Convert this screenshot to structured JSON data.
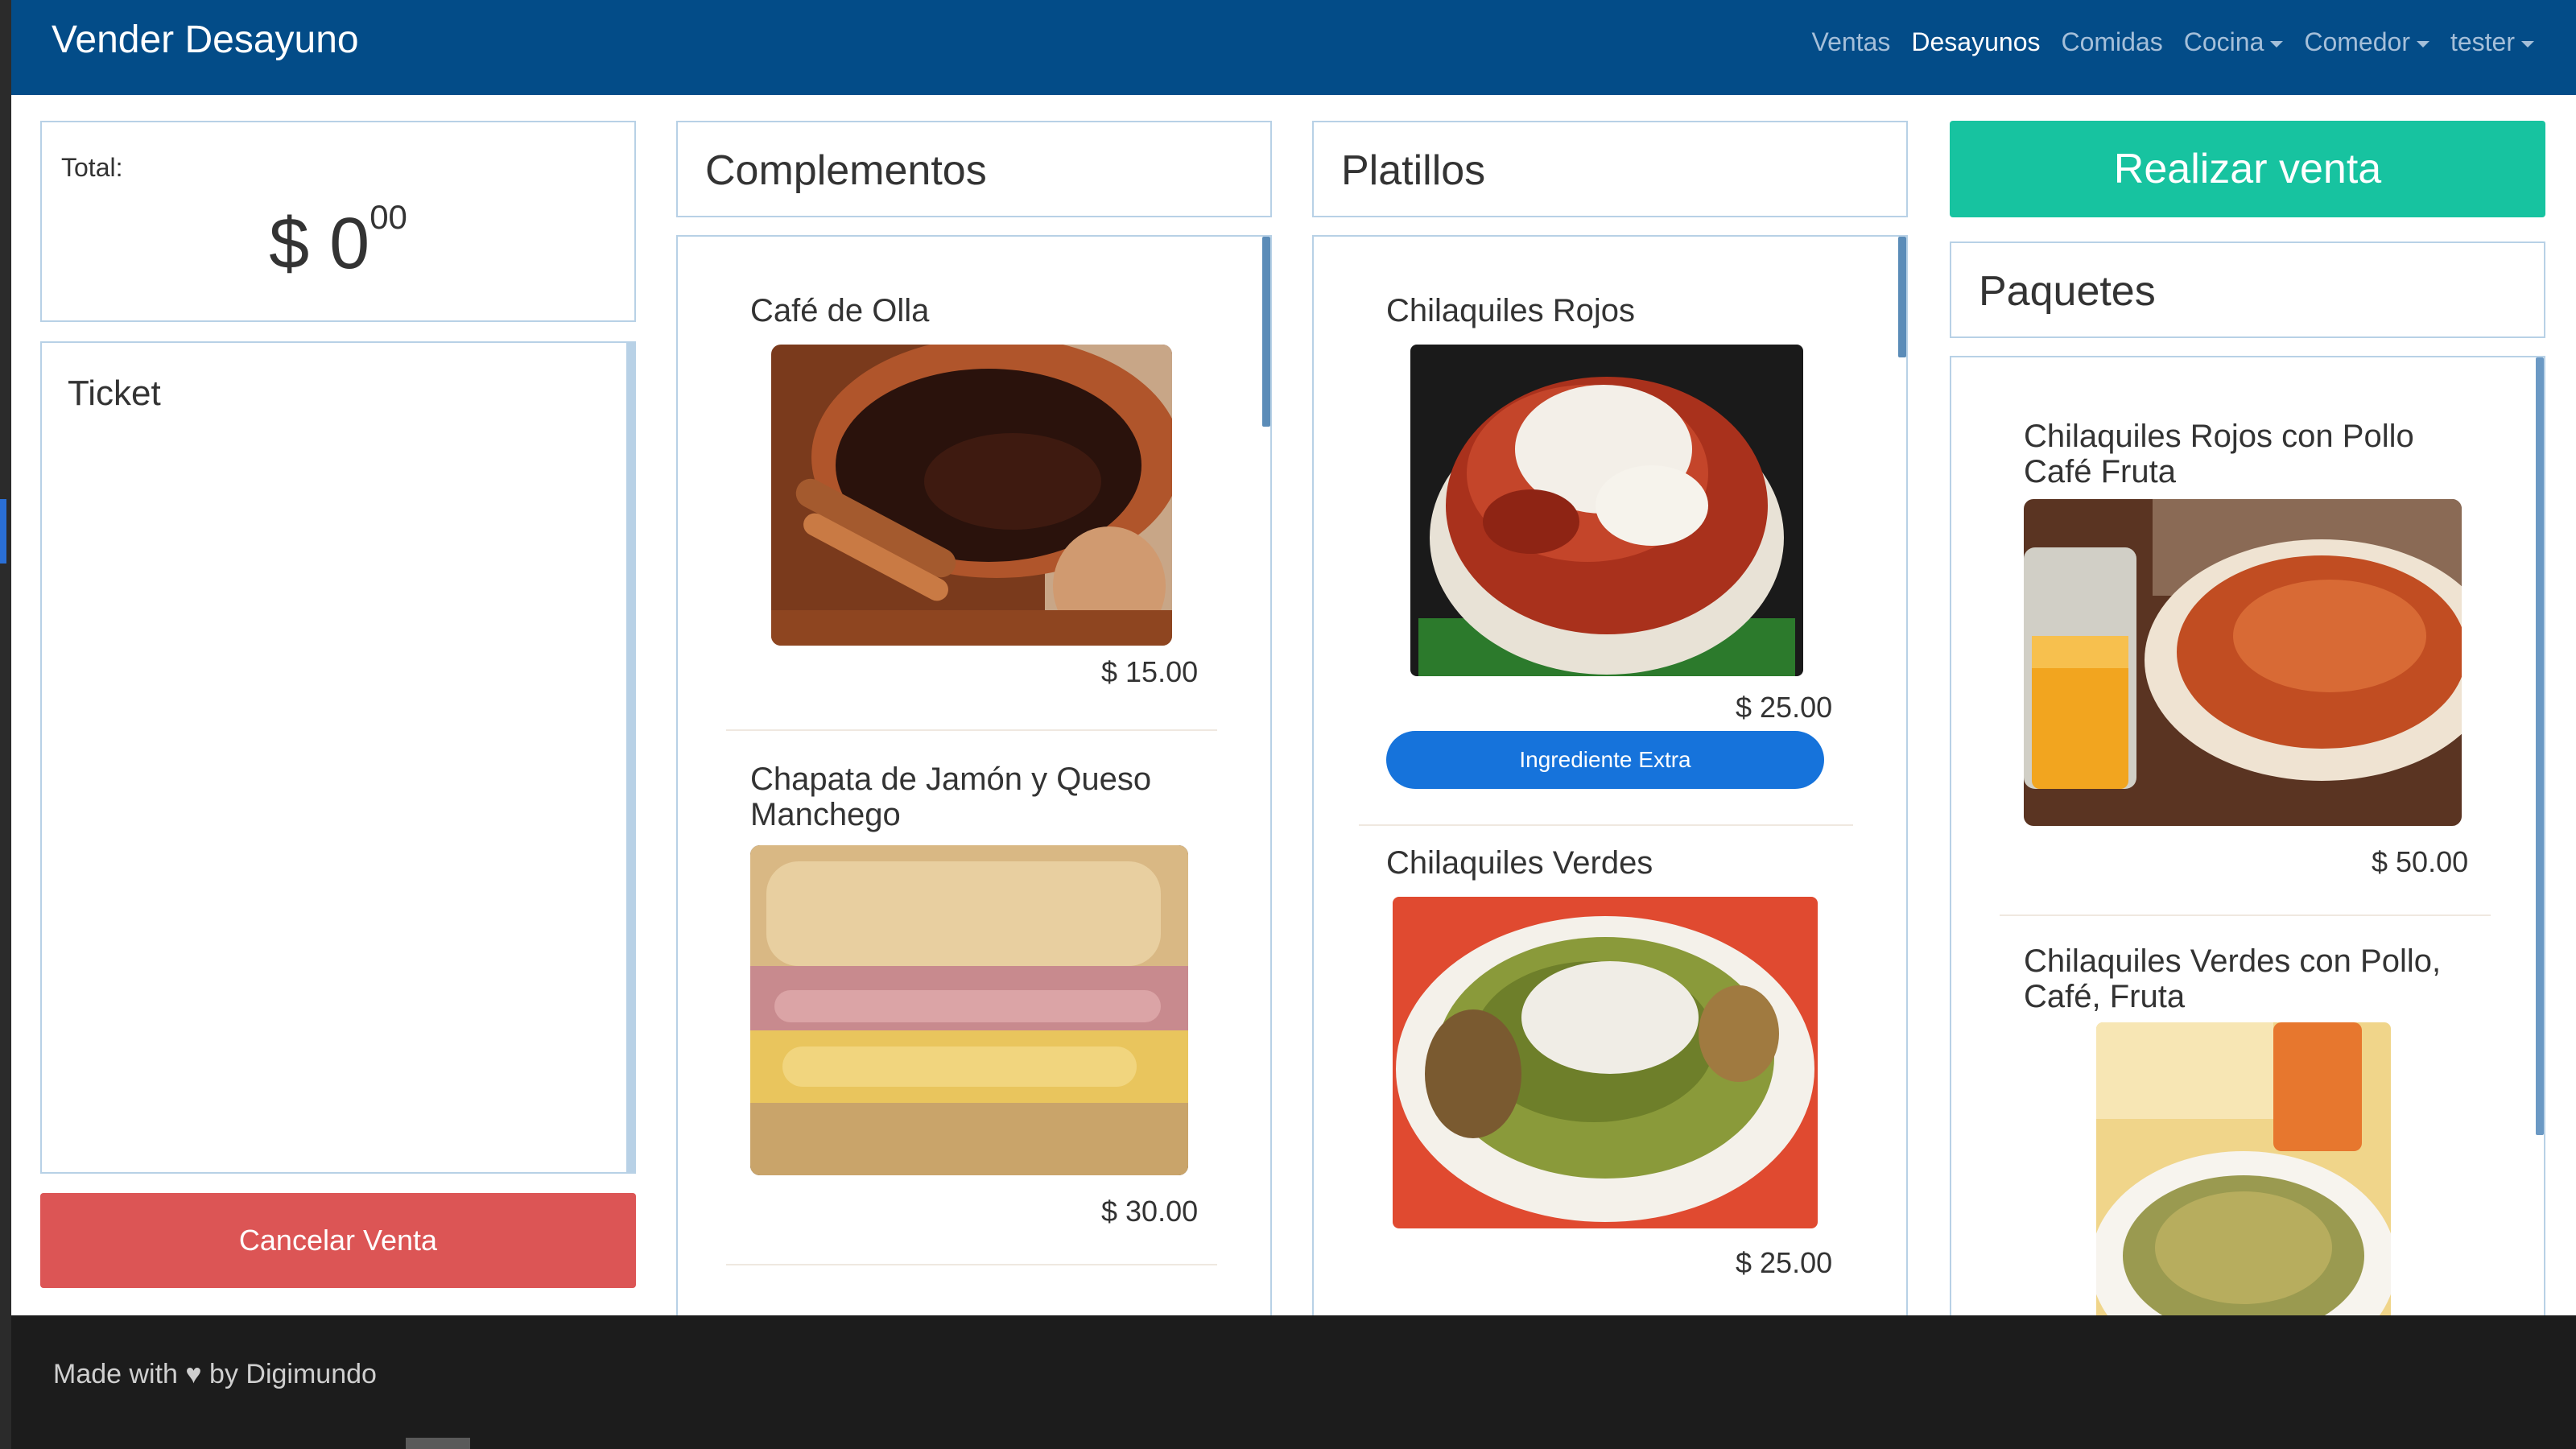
{
  "navbar": {
    "brand": "Vender Desayuno",
    "items": [
      {
        "label": "Ventas",
        "active": false,
        "dropdown": false
      },
      {
        "label": "Desayunos",
        "active": true,
        "dropdown": false
      },
      {
        "label": "Comidas",
        "active": false,
        "dropdown": false
      },
      {
        "label": "Cocina",
        "active": false,
        "dropdown": true
      },
      {
        "label": "Comedor",
        "active": false,
        "dropdown": true
      },
      {
        "label": "tester",
        "active": false,
        "dropdown": true
      }
    ]
  },
  "total": {
    "label": "Total:",
    "currency": "$",
    "amount": "0",
    "cents": "00"
  },
  "ticket": {
    "title": "Ticket"
  },
  "buttons": {
    "cancel": "Cancelar Venta",
    "sell": "Realizar venta",
    "extra": "Ingrediente Extra"
  },
  "complementos": {
    "title": "Complementos",
    "items": [
      {
        "name": "Café de Olla",
        "price": "$ 15.00",
        "image_icon": "clay-mug-coffee-photo"
      },
      {
        "name": "Chapata de Jamón y Queso Manchego",
        "price": "$ 30.00",
        "image_icon": "ham-cheese-sandwich-photo"
      }
    ]
  },
  "platillos": {
    "title": "Platillos",
    "items": [
      {
        "name": "Chilaquiles Rojos",
        "price": "$ 25.00",
        "image_icon": "red-chilaquiles-photo"
      },
      {
        "name": "Chilaquiles Verdes",
        "price": "$ 25.00",
        "image_icon": "green-chilaquiles-photo"
      }
    ]
  },
  "paquetes": {
    "title": "Paquetes",
    "items": [
      {
        "name": "Chilaquiles Rojos con Pollo Café Fruta",
        "price": "$ 50.00",
        "image_icon": "chilaquiles-with-juice-photo"
      },
      {
        "name": "Chilaquiles Verdes con Pollo, Café, Fruta",
        "image_icon": "green-chilaquiles-with-drink-photo"
      }
    ]
  },
  "footer": {
    "text": "Made with ♥ by Digimundo"
  },
  "colors": {
    "navbar": "#034c88",
    "sell": "#17c3a0",
    "cancel": "#dc5555",
    "extra": "#1673db"
  }
}
